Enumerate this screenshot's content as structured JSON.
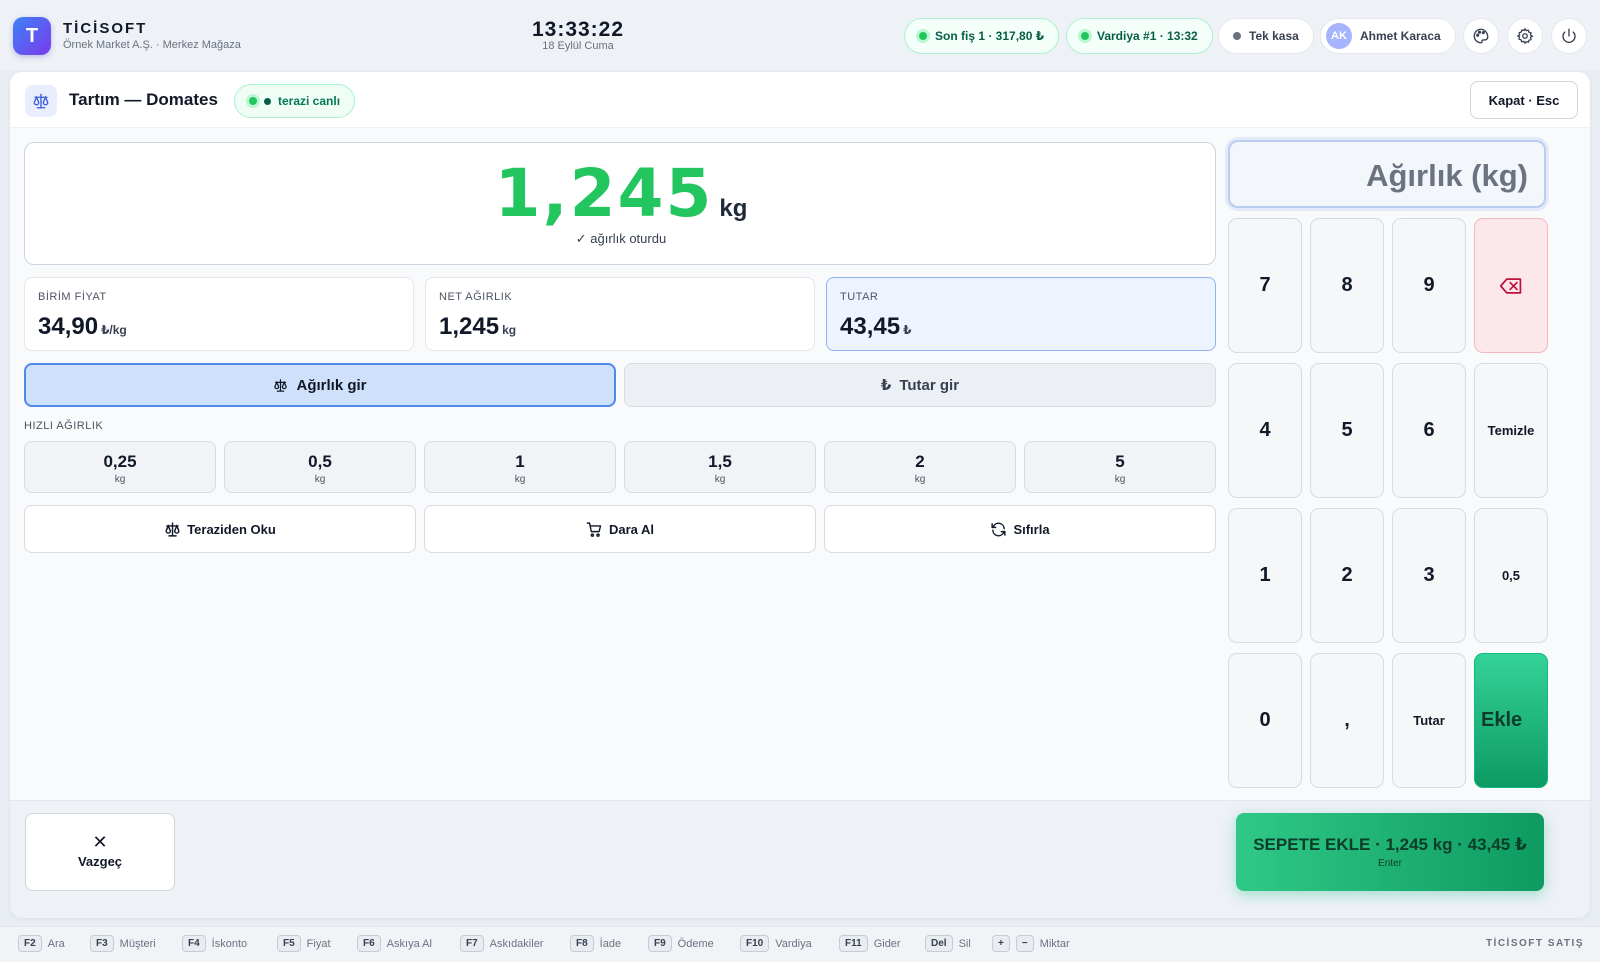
{
  "brand": {
    "logo_letter": "T",
    "name": "TİCİSOFT",
    "subtitle": "Örnek Market A.Ş. · Merkez Mağaza"
  },
  "clock": {
    "time": "13:33:22",
    "date": "18 Eylül Cuma"
  },
  "status": {
    "last_receipt": "Son fiş 1 · 317,80 ₺",
    "shift": "Vardiya #1 · 13:32",
    "register": "Tek kasa",
    "user_initials": "AK",
    "user_name": "Ahmet Karaca"
  },
  "icons": {
    "theme": "palette-icon",
    "settings": "gear-icon",
    "power": "power-icon"
  },
  "dialog": {
    "title": "Tartım — Domates",
    "scale_status": "terazi canlı",
    "close_label": "Kapat · Esc"
  },
  "weight": {
    "value": "1,245",
    "unit": "kg",
    "status": "✓ ağırlık oturdu"
  },
  "stats": {
    "unit_price": {
      "label": "BİRİM FİYAT",
      "value": "34,90",
      "unit": "₺/kg"
    },
    "net_weight": {
      "label": "NET AĞIRLIK",
      "value": "1,245",
      "unit": "kg"
    },
    "total": {
      "label": "TUTAR",
      "value": "43,45",
      "unit": "₺"
    }
  },
  "modes": {
    "weight": "Ağırlık gir",
    "amount": "Tutar gir",
    "active": "weight"
  },
  "quick": {
    "label": "HIZLI AĞIRLIK",
    "unit": "kg",
    "values": [
      "0,25",
      "0,5",
      "1",
      "1,5",
      "2",
      "5"
    ]
  },
  "actions": {
    "read_scale": "Teraziden Oku",
    "tare": "Dara Al",
    "reset": "Sıfırla"
  },
  "keypad": {
    "display_placeholder": "Ağırlık (kg)",
    "keys": [
      "7",
      "8",
      "9",
      "⌫",
      "4",
      "5",
      "6",
      "Temizle",
      "1",
      "2",
      "3",
      "0,5",
      "0",
      ",",
      "Tutar",
      "Ekle"
    ]
  },
  "footer": {
    "cancel": "Vazgeç",
    "add_to_cart": "SEPETE EKLE · 1,245 kg · 43,45 ₺",
    "add_hint": "Enter"
  },
  "shortcuts": [
    {
      "key": "F2",
      "label": "Ara"
    },
    {
      "key": "F3",
      "label": "Müşteri"
    },
    {
      "key": "F4",
      "label": "İskonto"
    },
    {
      "key": "F5",
      "label": "Fiyat"
    },
    {
      "key": "F6",
      "label": "Askıya Al"
    },
    {
      "key": "F7",
      "label": "Askıdakiler"
    },
    {
      "key": "F8",
      "label": "İade"
    },
    {
      "key": "F9",
      "label": "Ödeme"
    },
    {
      "key": "F10",
      "label": "Vardiya"
    },
    {
      "key": "F11",
      "label": "Gider"
    },
    {
      "key": "Del",
      "label": "Sil"
    },
    {
      "key": "+",
      "key2": "−",
      "label": "Miktar"
    }
  ],
  "footer_brand": "TİCİSOFT SATIŞ",
  "colors": {
    "accent": "#22c55e",
    "primary_blue": "#4f8ae8",
    "success_dark": "#0e9a61",
    "danger_bg": "#fce7ea"
  }
}
